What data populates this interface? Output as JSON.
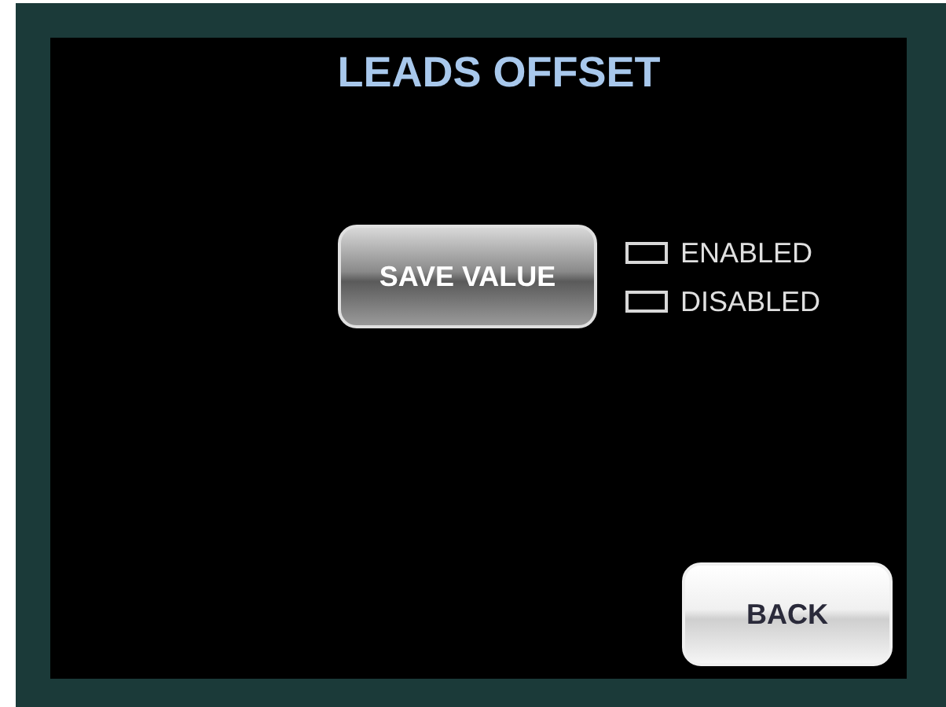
{
  "title": "LEADS OFFSET",
  "save_button": {
    "label": "SAVE VALUE"
  },
  "options": [
    {
      "label": "ENABLED",
      "checked": false
    },
    {
      "label": "DISABLED",
      "checked": false
    }
  ],
  "back_button": {
    "label": "BACK"
  }
}
